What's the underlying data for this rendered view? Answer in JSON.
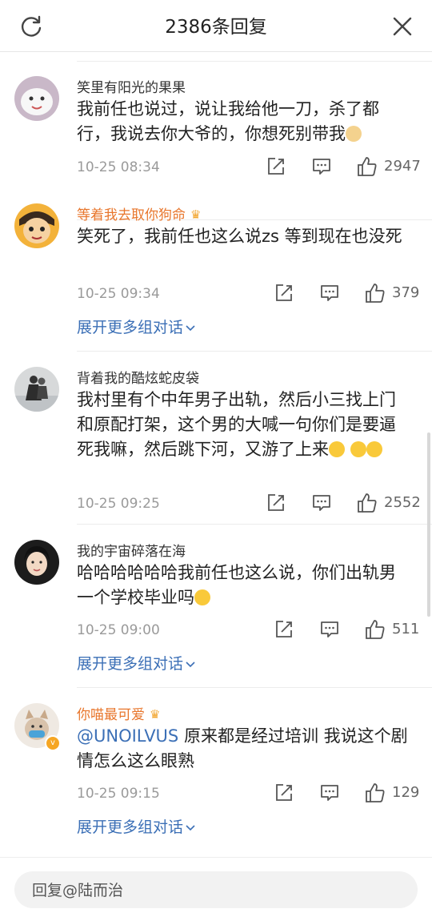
{
  "header": {
    "title": "2386条回复"
  },
  "comments": [
    {
      "name": "笑里有阳光的果果",
      "text": "我前任也说过，说让我给他一刀，杀了都行，我说去你大爷的，你想死别带我",
      "time": "10-25 08:34",
      "likes": "2947"
    },
    {
      "name": "等着我去取你狗命",
      "text": "笑死了，我前任也这么说zs 等到现在也没死",
      "time": "10-25 09:34",
      "likes": "379",
      "more": "展开更多组对话"
    },
    {
      "name": "背着我的酷炫蛇皮袋",
      "text": "我村里有个中年男子出轨，然后小三找上门和原配打架，这个男的大喊一句你们是要逼死我嘛，然后跳下河，又游了上来",
      "time": "10-25 09:25",
      "likes": "2552"
    },
    {
      "name": "我的宇宙碎落在海",
      "text": "哈哈哈哈哈哈我前任也这么说，你们出轨男一个学校毕业吗",
      "time": "10-25 09:00",
      "likes": "511",
      "more": "展开更多组对话"
    },
    {
      "name": "你喵最可爱",
      "mention": "@UNOILVUS",
      "text": " 原来都是经过培训 我说这个剧情怎么这么眼熟",
      "time": "10-25 09:15",
      "likes": "129",
      "more": "展开更多组对话"
    }
  ],
  "reply": {
    "placeholder": "回复@陆而治"
  },
  "icons": {
    "refresh": "refresh-icon",
    "close": "close-icon",
    "share": "share-icon",
    "comment": "comment-icon",
    "like": "like-icon",
    "crown": "crown-icon"
  },
  "colors": {
    "vip_name": "#e8762c",
    "link": "#3b6fb6",
    "meta": "#9a9a9a"
  }
}
